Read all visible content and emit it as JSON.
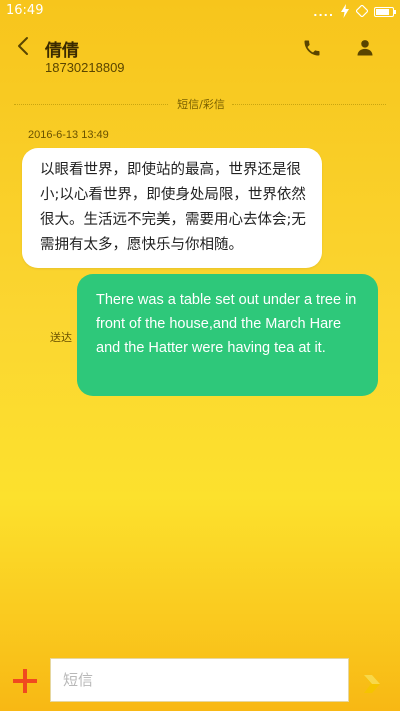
{
  "status_bar": {
    "time": "16:49",
    "signal_dots": "....",
    "battery_level": 0.8
  },
  "header": {
    "contact_name": "倩倩",
    "contact_number": "18730218809"
  },
  "conversation": {
    "channel_label": "短信/彩信",
    "timestamp": "2016-6-13 13:49",
    "messages": [
      {
        "direction": "incoming",
        "text": "以眼看世界，即使站的最高，世界还是很小;以心看世界，即使身处局限，世界依然很大。生活远不完美，需要用心去体会;无需拥有太多，愿快乐与你相随。"
      },
      {
        "direction": "outgoing",
        "text": "There was a table set out under a tree in front of the house,and the March Hare and the Hatter were having tea at it.",
        "status": "送达"
      }
    ]
  },
  "composer": {
    "placeholder": "短信",
    "value": ""
  },
  "icons": {
    "back": "chevron-left-icon",
    "call": "phone-icon",
    "contact": "person-icon",
    "add": "plus-icon",
    "send": "send-icon"
  },
  "colors": {
    "background_top": "#f7c51c",
    "background_bottom": "#fce12d",
    "outgoing_bubble": "#2ec87a",
    "incoming_bubble": "#ffffff",
    "add_button": "#f04a1f",
    "send_button": "#f5c400",
    "header_icon": "#5a4500"
  }
}
